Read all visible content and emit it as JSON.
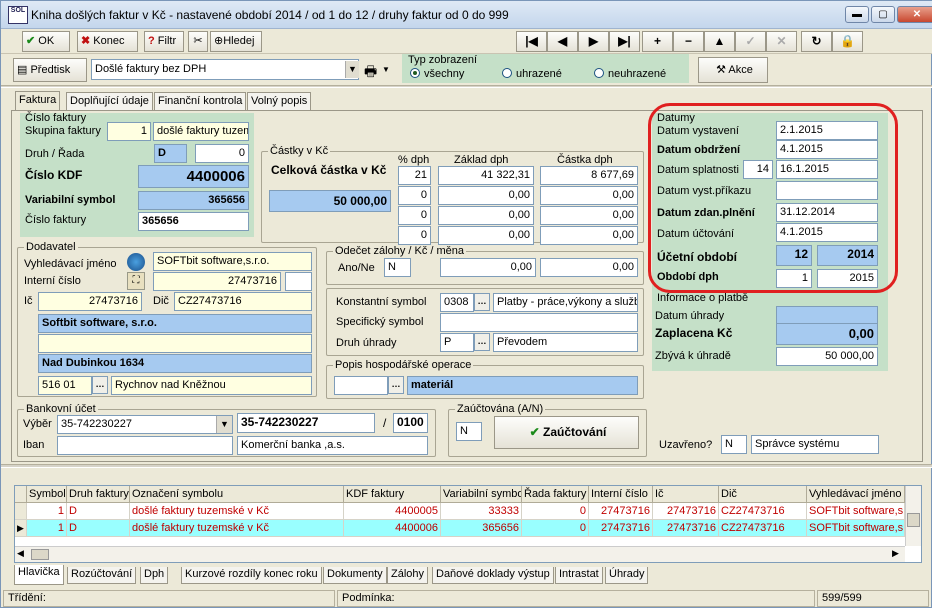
{
  "window": {
    "title": "Kniha došlých faktur v Kč - nastavené období 2014 / od 1 do 12 / druhy faktur od 0 do 999",
    "logo_text": "SOL"
  },
  "toolbar": {
    "ok": "OK",
    "konec": "Konec",
    "filtr": "Filtr",
    "hledej": "Hledej",
    "nav": [
      "|◀",
      "◀",
      "▶",
      "▶|",
      "+",
      "−",
      "▲",
      "✓",
      "✕",
      "↻",
      "🔒"
    ]
  },
  "row2": {
    "predtisk": "Předtisk",
    "report": "Došlé faktury bez DPH",
    "typ_title": "Typ zobrazení",
    "typ_options": [
      "všechny",
      "uhrazené",
      "neuhrazené"
    ],
    "akce": "Akce"
  },
  "tabs": [
    "Faktura",
    "Doplňující údaje",
    "Finanční kontrola",
    "Volný popis"
  ],
  "cislo": {
    "title": "Číslo faktury",
    "skupina_label": "Skupina faktury",
    "skupina_num": "1",
    "skupina_text": "došlé faktury tuzem",
    "druh_label": "Druh / Řada",
    "druh": "D",
    "rada": "0",
    "kdf_label": "Číslo KDF",
    "kdf": "4400006",
    "vs_label": "Variabilní symbol",
    "vs": "365656",
    "cf_label": "Číslo faktury",
    "cf": "365656"
  },
  "castky": {
    "title": "Částky v Kč",
    "celkova_label": "Celková částka v Kč",
    "celkova": "50 000,00",
    "h_dph": "% dph",
    "h_zaklad": "Základ dph",
    "h_castka": "Částka dph",
    "rows": [
      {
        "dph": "21",
        "zaklad": "41 322,31",
        "castka": "8 677,69"
      },
      {
        "dph": "0",
        "zaklad": "0,00",
        "castka": "0,00"
      },
      {
        "dph": "0",
        "zaklad": "0,00",
        "castka": "0,00"
      },
      {
        "dph": "0",
        "zaklad": "0,00",
        "castka": "0,00"
      }
    ]
  },
  "datumy": {
    "title": "Datumy",
    "vystaveni_label": "Datum vystavení",
    "vystaveni": "2.1.2015",
    "obdrzeni_label": "Datum obdržení",
    "obdrzeni": "4.1.2015",
    "splatnosti_label": "Datum splatnosti",
    "splatnosti_days": "14",
    "splatnosti": "16.1.2015",
    "vystprik_label": "Datum vyst.příkazu",
    "vystprik": "",
    "zdan_label": "Datum zdan.plnění",
    "zdan": "31.12.2014",
    "uctovani_label": "Datum účtování",
    "uctovani": "4.1.2015",
    "ucetni_label": "Účetní období",
    "ucetni_mesic": "12",
    "ucetni_rok": "2014",
    "dph_label": "Období dph",
    "dph_mesic": "1",
    "dph_rok": "2015"
  },
  "platba": {
    "title": "Informace o platbě",
    "uhrady_label": "Datum úhrady",
    "uhrady": "",
    "zaplaceno_label": "Zaplacena Kč",
    "zaplaceno": "0,00",
    "zbyva_label": "Zbývá k úhradě",
    "zbyva": "50 000,00"
  },
  "dodavatel": {
    "title": "Dodavatel",
    "vyhl_label": "Vyhledávací jméno",
    "vyhl": "SOFTbit software,s.r.o.",
    "interni_label": "Interní číslo",
    "interni": "27473716",
    "ic_label": "Ič",
    "ic": "27473716",
    "dic_label": "Dič",
    "dic": "CZ27473716",
    "nazev": "Softbit software, s.r.o.",
    "nazev2": "",
    "ulice": "Nad Dubinkou 1634",
    "psc": "516 01",
    "mesto": "Rychnov nad Kněžnou"
  },
  "odecet": {
    "title": "Odečet zálohy / Kč / měna",
    "anone_label": "Ano/Ne",
    "anone": "N",
    "v1": "0,00",
    "v2": "0,00"
  },
  "symboly": {
    "konst_label": "Konstantní symbol",
    "konst": "0308",
    "konst_text": "Platby - práce,výkony a služby",
    "spec_label": "Specifický symbol",
    "spec": "",
    "druh_label": "Druh úhrady",
    "druh": "P",
    "druh_text": "Převodem"
  },
  "popis": {
    "title": "Popis hospodářské operace",
    "code": "",
    "text": "materiál"
  },
  "banka": {
    "title": "Bankovní účet",
    "vyber_label": "Výběr",
    "vyber": "35-742230227",
    "iban_label": "Iban",
    "iban": "",
    "ucet": "35-742230227",
    "slash": "/",
    "kod": "0100",
    "nazev": "Komerční banka ,a.s."
  },
  "zauct": {
    "title": "Zaúčtována (A/N)",
    "value": "N",
    "button": "Zaúčtování"
  },
  "uzavreno": {
    "label": "Uzavřeno?",
    "value": "N",
    "user": "Správce systému"
  },
  "grid": {
    "headers": [
      "Symbol",
      "Druh faktury",
      "Označení symbolu",
      "KDF faktury",
      "Variabilní symbol",
      "Řada faktury",
      "Interní číslo",
      "Ič",
      "Dič",
      "Vyhledávací jméno"
    ],
    "rows": [
      [
        "1",
        "D",
        "došlé faktury tuzemské v Kč",
        "4400005",
        "33333",
        "0",
        "27473716",
        "27473716",
        "CZ27473716",
        "SOFTbit software,s.r.o."
      ],
      [
        "1",
        "D",
        "došlé faktury tuzemské v Kč",
        "4400006",
        "365656",
        "0",
        "27473716",
        "27473716",
        "CZ27473716",
        "SOFTbit software,s.r.o."
      ]
    ]
  },
  "bottom_tabs": [
    "Hlavička",
    "Rozúčtování",
    "Dph",
    "Kurzové rozdíly konec roku",
    "Dokumenty",
    "Zálohy",
    "Daňové doklady výstup",
    "Intrastat",
    "Úhrady"
  ],
  "statusbar": {
    "trideni": "Třídění:",
    "podminka": "Podmínka:",
    "count": "599/599"
  }
}
